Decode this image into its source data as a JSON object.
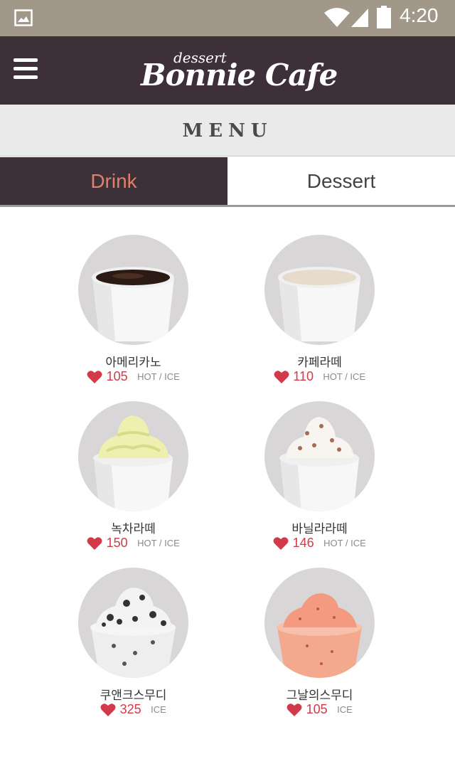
{
  "status_bar": {
    "time": "4:20"
  },
  "header": {
    "logo_small": "dessert",
    "logo_main": "Bonnie Cafe"
  },
  "section_title": "MENU",
  "tabs": [
    {
      "label": "Drink",
      "active": true
    },
    {
      "label": "Dessert",
      "active": false
    }
  ],
  "items": [
    {
      "name": "아메리카노",
      "likes": "105",
      "temp": "HOT / ICE",
      "drink": "coffee"
    },
    {
      "name": "카페라떼",
      "likes": "110",
      "temp": "HOT / ICE",
      "drink": "latte"
    },
    {
      "name": "녹차라떼",
      "likes": "150",
      "temp": "HOT / ICE",
      "drink": "greentea"
    },
    {
      "name": "바닐라라떼",
      "likes": "146",
      "temp": "HOT / ICE",
      "drink": "vanilla"
    },
    {
      "name": "쿠앤크스무디",
      "likes": "325",
      "temp": "ICE",
      "drink": "cookies"
    },
    {
      "name": "그날의스무디",
      "likes": "105",
      "temp": "ICE",
      "drink": "fruit"
    }
  ],
  "colors": {
    "topbar": "#3e3039",
    "accent": "#e08068",
    "heart": "#d23a4a",
    "statusbar": "#a29889"
  }
}
